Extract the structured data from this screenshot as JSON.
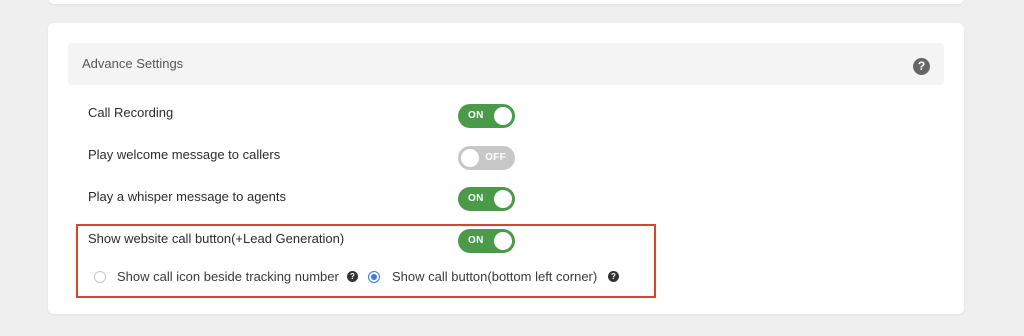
{
  "section": {
    "title": "Advance Settings",
    "help_icon": "?"
  },
  "settings": [
    {
      "label": "Call Recording",
      "state": "ON"
    },
    {
      "label": "Play welcome message to callers",
      "state": "OFF"
    },
    {
      "label": "Play a whisper message to agents",
      "state": "ON"
    },
    {
      "label": "Show website call button(+Lead Generation)",
      "state": "ON"
    }
  ],
  "call_button_options": [
    {
      "label": "Show call icon beside tracking number",
      "selected": false,
      "help_icon": "?"
    },
    {
      "label": "Show call button(bottom left corner)",
      "selected": true,
      "help_icon": "?"
    }
  ],
  "colors": {
    "toggle_on": "#4a9a4a",
    "toggle_off": "#c7c7c7",
    "highlight_border": "#d9442f",
    "radio_selected": "#3b7be0"
  }
}
